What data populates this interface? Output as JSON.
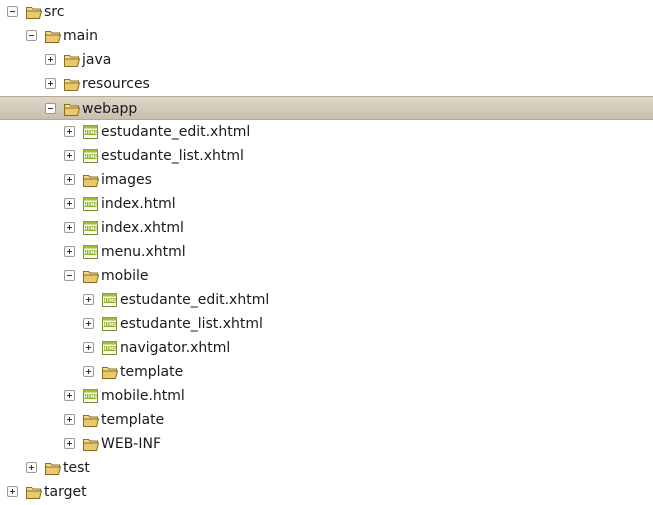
{
  "tree": {
    "items": [
      {
        "label": "src",
        "type": "folder",
        "expanded": true,
        "level": 0
      },
      {
        "label": "main",
        "type": "folder",
        "expanded": true,
        "level": 1
      },
      {
        "label": "java",
        "type": "folder",
        "expanded": false,
        "level": 2
      },
      {
        "label": "resources",
        "type": "folder",
        "expanded": false,
        "level": 2
      },
      {
        "label": "webapp",
        "type": "folder",
        "expanded": true,
        "level": 2,
        "selected": true
      },
      {
        "label": "estudante_edit.xhtml",
        "type": "html-file",
        "expanded": false,
        "level": 3
      },
      {
        "label": "estudante_list.xhtml",
        "type": "html-file",
        "expanded": false,
        "level": 3
      },
      {
        "label": "images",
        "type": "folder",
        "expanded": false,
        "level": 3
      },
      {
        "label": "index.html",
        "type": "html-file",
        "expanded": false,
        "level": 3
      },
      {
        "label": "index.xhtml",
        "type": "html-file",
        "expanded": false,
        "level": 3
      },
      {
        "label": "menu.xhtml",
        "type": "html-file",
        "expanded": false,
        "level": 3
      },
      {
        "label": "mobile",
        "type": "folder",
        "expanded": true,
        "level": 3
      },
      {
        "label": "estudante_edit.xhtml",
        "type": "html-file",
        "expanded": false,
        "level": 4
      },
      {
        "label": "estudante_list.xhtml",
        "type": "html-file",
        "expanded": false,
        "level": 4
      },
      {
        "label": "navigator.xhtml",
        "type": "html-file",
        "expanded": false,
        "level": 4
      },
      {
        "label": "template",
        "type": "folder",
        "expanded": false,
        "level": 4
      },
      {
        "label": "mobile.html",
        "type": "html-file",
        "expanded": false,
        "level": 3
      },
      {
        "label": "template",
        "type": "folder",
        "expanded": false,
        "level": 3
      },
      {
        "label": "WEB-INF",
        "type": "folder",
        "expanded": false,
        "level": 3
      },
      {
        "label": "test",
        "type": "folder",
        "expanded": false,
        "level": 1
      },
      {
        "label": "target",
        "type": "folder",
        "expanded": false,
        "level": 0
      }
    ]
  },
  "icons": {
    "folder": "folder-icon",
    "html-file": "html-file-icon",
    "expand": "expand-plus-icon",
    "collapse": "collapse-minus-icon"
  },
  "colors": {
    "selection": "#cfc6b5",
    "folder": "#e8c96c",
    "html_badge": "#7a9a1a"
  }
}
